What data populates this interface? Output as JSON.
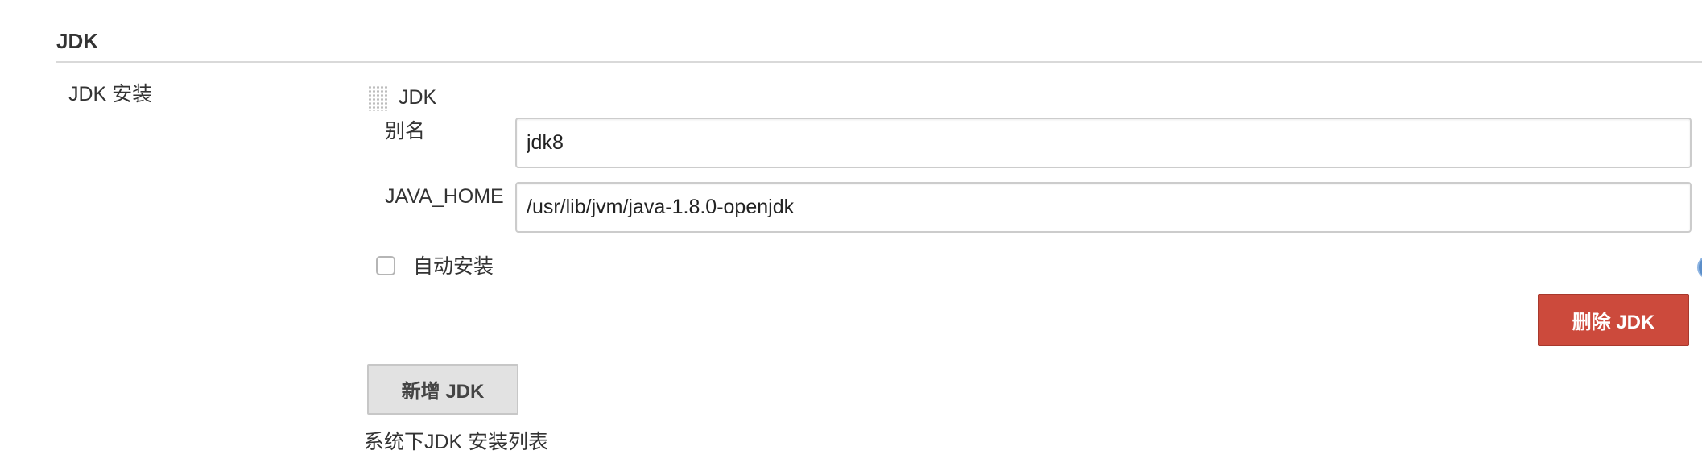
{
  "section": {
    "title": "JDK"
  },
  "jdk_installations": {
    "label": "JDK 安装",
    "entry": {
      "header": "JDK",
      "name_label": "别名",
      "name_value": "jdk8",
      "java_home_label": "JAVA_HOME",
      "java_home_value": "/usr/lib/jvm/java-1.8.0-openjdk",
      "auto_install_label": "自动安装",
      "auto_install_checked": false,
      "delete_button": "删除 JDK"
    },
    "add_button": "新增 JDK",
    "description": "系统下JDK 安装列表"
  },
  "colors": {
    "danger": "#cc4a3c",
    "default_button": "#e2e2e2",
    "help_icon": "#5b8ec9"
  },
  "icons": [
    "drag-handle-icon",
    "help-icon"
  ]
}
